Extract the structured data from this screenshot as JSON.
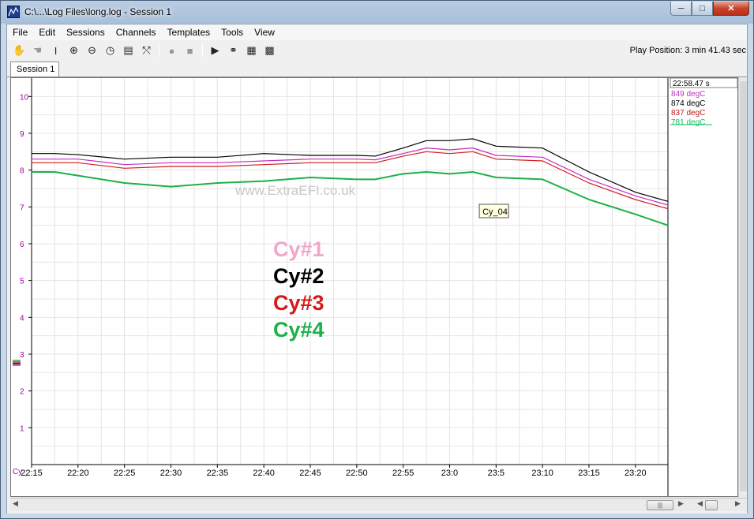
{
  "window": {
    "title": "C:\\...\\Log Files\\long.log - Session 1",
    "minimize_label": "─",
    "maximize_label": "□",
    "close_label": "✕"
  },
  "menu": [
    "File",
    "Edit",
    "Sessions",
    "Channels",
    "Templates",
    "Tools",
    "View"
  ],
  "toolbar": {
    "buttons": [
      {
        "name": "hand-icon",
        "glyph": "✋",
        "enabled": true
      },
      {
        "name": "grab-hand-icon",
        "glyph": "☚",
        "enabled": false
      },
      {
        "name": "cursor-i-beam-icon",
        "glyph": "I",
        "enabled": true
      },
      {
        "name": "zoom-in-icon",
        "glyph": "⊕",
        "enabled": true
      },
      {
        "name": "zoom-out-icon",
        "glyph": "⊖",
        "enabled": true
      },
      {
        "name": "clock-icon",
        "glyph": "◷",
        "enabled": true
      },
      {
        "name": "notes-icon",
        "glyph": "▤",
        "enabled": true
      },
      {
        "name": "chart-reset-icon",
        "glyph": "⤲",
        "enabled": true
      },
      {
        "name": "record-icon",
        "glyph": "●",
        "enabled": false
      },
      {
        "name": "stop-icon",
        "glyph": "■",
        "enabled": false
      },
      {
        "name": "play-icon",
        "glyph": "▶",
        "enabled": true
      },
      {
        "name": "binoculars-icon",
        "glyph": "⚭",
        "enabled": true
      },
      {
        "name": "scatter-plot-icon",
        "glyph": "▦",
        "enabled": true
      },
      {
        "name": "table-icon",
        "glyph": "▩",
        "enabled": true
      }
    ],
    "play_position": "Play Position: 3 min 41.43 sec"
  },
  "tabs": [
    {
      "label": "Session 1",
      "active": true
    }
  ],
  "watermark": "www.ExtraEFI.co.uk",
  "tooltip": "Cy_04",
  "cursor_readout": {
    "time": "22:58.47 s",
    "values": [
      {
        "text": "849 degC",
        "color": "#c030c0"
      },
      {
        "text": "874 degC",
        "color": "#000000"
      },
      {
        "text": "837 degC",
        "color": "#c01818"
      },
      {
        "text": "781 degC",
        "color": "#10c060"
      }
    ]
  },
  "axis_channel_label": "Cy_",
  "chart_data": {
    "type": "line",
    "x_tick_labels": [
      "22:15",
      "22:20",
      "22:25",
      "22:30",
      "22:35",
      "22:40",
      "22:45",
      "22:50",
      "22:55",
      "23:0",
      "23:5",
      "23:10",
      "23:15",
      "23:20"
    ],
    "y_tick_labels": [
      "1",
      "2",
      "3",
      "4",
      "5",
      "6",
      "7",
      "8",
      "9",
      "10"
    ],
    "ylim": [
      0,
      10.5
    ],
    "xlim": [
      0,
      13.7
    ],
    "grid": true,
    "legend": [
      {
        "label": "Cy#1",
        "color": "#f4a6c8"
      },
      {
        "label": "Cy#2",
        "color": "#000000"
      },
      {
        "label": "Cy#3",
        "color": "#d41c1c"
      },
      {
        "label": "Cy#4",
        "color": "#1cb048"
      }
    ],
    "series": [
      {
        "name": "Cy#1",
        "color": "#c030c0",
        "x": [
          0,
          0.5,
          1,
          2,
          3,
          4,
          5,
          6,
          7,
          7.4,
          8,
          8.5,
          9,
          9.5,
          10,
          11,
          12,
          13,
          13.7
        ],
        "values": [
          8.3,
          8.3,
          8.3,
          8.15,
          8.2,
          8.2,
          8.25,
          8.3,
          8.3,
          8.28,
          8.45,
          8.6,
          8.55,
          8.6,
          8.4,
          8.35,
          7.75,
          7.3,
          7.05
        ]
      },
      {
        "name": "Cy#2",
        "color": "#000000",
        "x": [
          0,
          0.5,
          1,
          2,
          3,
          4,
          5,
          6,
          7,
          7.4,
          8,
          8.5,
          9,
          9.5,
          10,
          11,
          12,
          13,
          13.7
        ],
        "values": [
          8.45,
          8.45,
          8.42,
          8.3,
          8.35,
          8.35,
          8.45,
          8.4,
          8.4,
          8.38,
          8.6,
          8.8,
          8.8,
          8.85,
          8.65,
          8.6,
          7.95,
          7.4,
          7.15
        ]
      },
      {
        "name": "Cy#3",
        "color": "#d41c1c",
        "x": [
          0,
          0.5,
          1,
          2,
          3,
          4,
          5,
          6,
          7,
          7.4,
          8,
          8.5,
          9,
          9.5,
          10,
          11,
          12,
          13,
          13.7
        ],
        "values": [
          8.2,
          8.2,
          8.2,
          8.05,
          8.1,
          8.1,
          8.15,
          8.2,
          8.2,
          8.2,
          8.38,
          8.5,
          8.45,
          8.5,
          8.3,
          8.25,
          7.65,
          7.2,
          6.95
        ]
      },
      {
        "name": "Cy#4",
        "color": "#1cb048",
        "x": [
          0,
          0.5,
          1,
          2,
          3,
          4,
          5,
          6,
          7,
          7.4,
          8,
          8.5,
          9,
          9.5,
          10,
          11,
          12,
          13,
          13.7
        ],
        "values": [
          7.95,
          7.95,
          7.85,
          7.65,
          7.55,
          7.65,
          7.7,
          7.8,
          7.75,
          7.75,
          7.9,
          7.95,
          7.9,
          7.95,
          7.8,
          7.75,
          7.2,
          6.8,
          6.5
        ]
      }
    ]
  }
}
